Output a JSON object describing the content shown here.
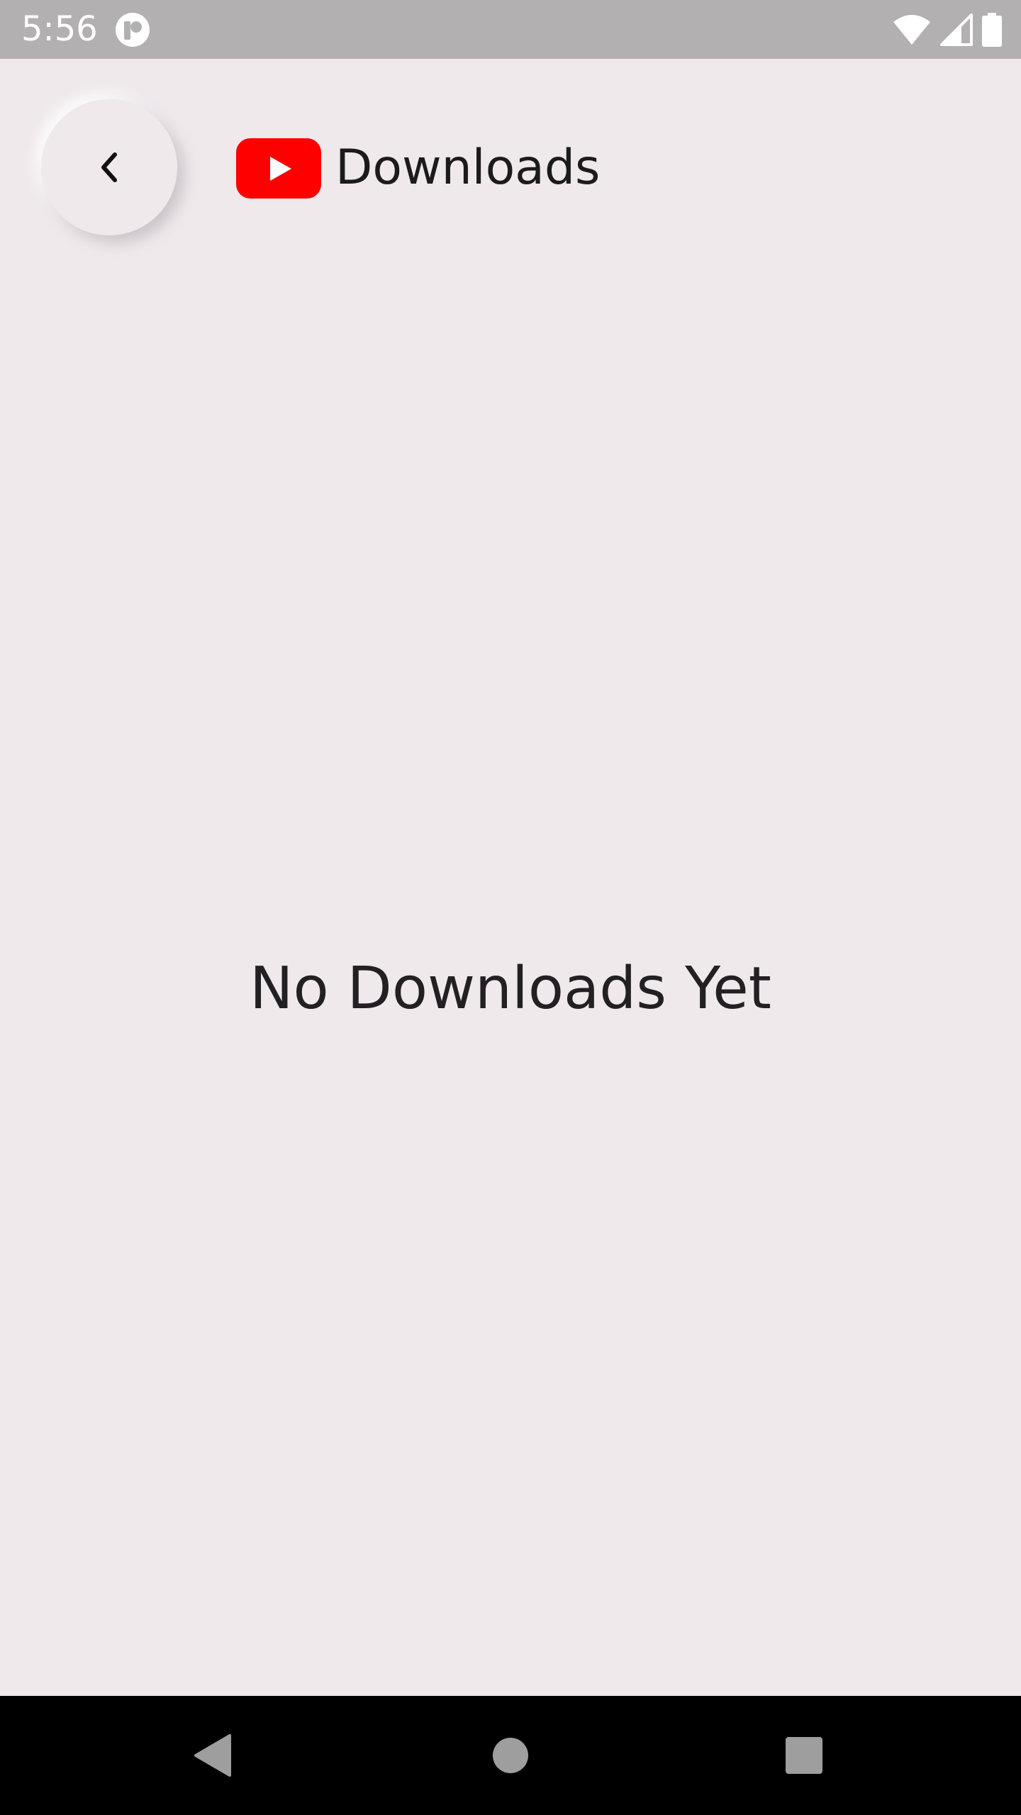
{
  "status_bar": {
    "time": "5:56",
    "icons": [
      "app-notification-icon",
      "wifi-icon",
      "cellular-signal-icon",
      "battery-icon"
    ]
  },
  "header": {
    "back_icon": "chevron-left-icon",
    "logo_icon": "youtube-logo-icon",
    "title": "Downloads"
  },
  "main": {
    "empty_message": "No Downloads Yet"
  },
  "nav_bar": {
    "buttons": [
      "back-triangle-icon",
      "home-circle-icon",
      "recents-square-icon"
    ]
  },
  "colors": {
    "background": "#efe9ec",
    "status_bar": "#b3b0b1",
    "brand_red": "#ff0000",
    "text": "#1c1b1c",
    "nav_bar": "#000000",
    "nav_icons": "#9e9e9e"
  }
}
